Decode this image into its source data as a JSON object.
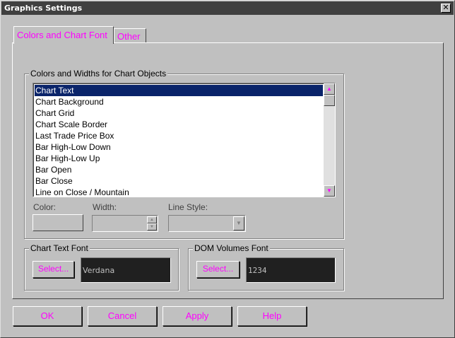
{
  "window": {
    "title": "Graphics Settings",
    "close_glyph": "✕"
  },
  "tabs": [
    {
      "label": "Colors and Chart Font",
      "active": true
    },
    {
      "label": "Other",
      "active": false
    }
  ],
  "objects_group": {
    "label": "Colors and Widths for Chart Objects",
    "items": [
      "Chart Text",
      "Chart Background",
      "Chart Grid",
      "Chart Scale Border",
      "Last Trade Price Box",
      "Bar High-Low Down",
      "Bar High-Low Up",
      "Bar Open",
      "Bar Close",
      "Line on Close / Mountain"
    ],
    "selected_index": 0,
    "color_label": "Color:",
    "width_label": "Width:",
    "line_style_label": "Line Style:"
  },
  "chart_text_font": {
    "label": "Chart Text Font",
    "select_label": "Select...",
    "preview": "Verdana"
  },
  "dom_volumes_font": {
    "label": "DOM Volumes Font",
    "select_label": "Select...",
    "preview": "1234"
  },
  "buttons": {
    "ok": "OK",
    "cancel": "Cancel",
    "apply": "Apply",
    "help": "Help"
  },
  "colors": {
    "accent_text": "#ff00ff",
    "selection": "#0a246a",
    "titlebar": "#404040",
    "face": "#c0c0c0",
    "font_preview_bg": "#202020"
  },
  "icons": {
    "scroll_up": "triangle-up-icon",
    "scroll_down": "triangle-down-icon",
    "combo": "chevron-down-icon",
    "close": "close-icon"
  }
}
